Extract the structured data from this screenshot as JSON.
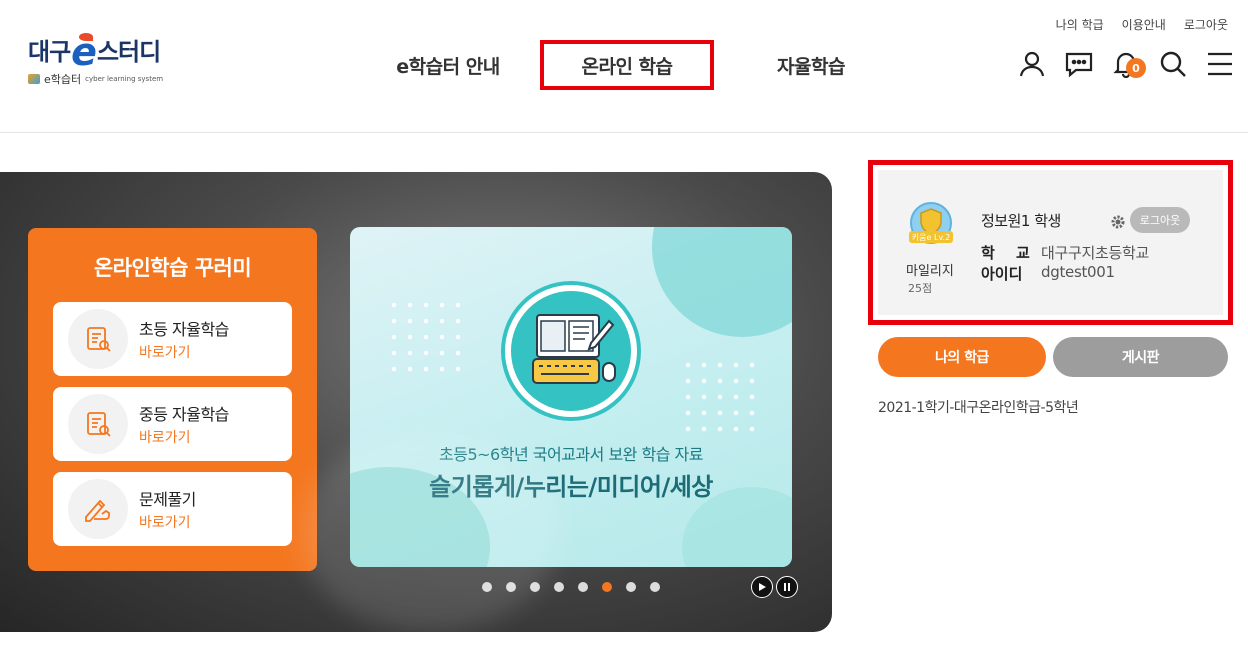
{
  "util_links": [
    "나의 학급",
    "이용안내",
    "로그아웃"
  ],
  "logo": {
    "main_left": "대구",
    "main_e": "e",
    "main_right": "스터디",
    "sub": "e학습터",
    "sub_en": "cyber learning system"
  },
  "nav": {
    "items": [
      "e학습터 안내",
      "온라인 학습",
      "자율학습"
    ]
  },
  "header_icons": {
    "notification_count": "0"
  },
  "hero": {
    "panel_title": "온라인학습 꾸러미",
    "cards": [
      {
        "title": "초등 자율학습",
        "link": "바로가기"
      },
      {
        "title": "중등 자율학습",
        "link": "바로가기"
      },
      {
        "title": "문제풀기",
        "link": "바로가기"
      }
    ],
    "banner": {
      "line1": "초등5~6학년 국어교과서 보완 학습 자료",
      "line2": "슬기롭게/누리는/미디어/세상"
    },
    "pager": {
      "total": 8,
      "active": 6
    }
  },
  "profile": {
    "badge_text": "키움e Lv.2",
    "mileage_label": "마일리지",
    "points": "25점",
    "name": "정보원1 학생",
    "logout": "로그아웃",
    "school_label": "학 교",
    "school": "대구구지초등학교",
    "id_label": "아이디",
    "id": "dgtest001"
  },
  "buttons": {
    "my_class": "나의 학급",
    "board": "게시판"
  },
  "course": "2021-1학기-대구온라인학급-5학년",
  "colors": {
    "accent": "#f47720",
    "highlight": "#e8000b",
    "brand": "#1b3566"
  }
}
